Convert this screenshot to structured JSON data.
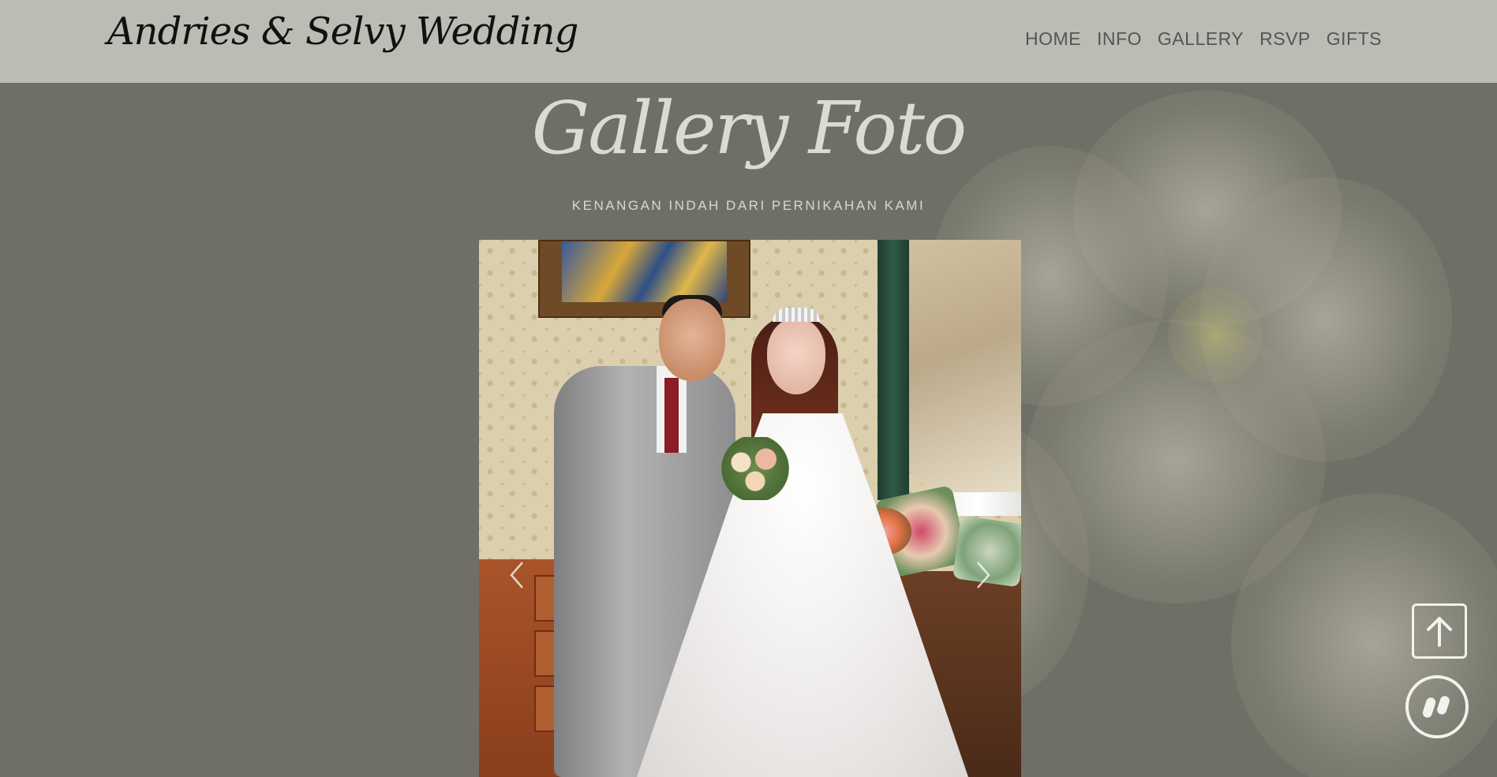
{
  "header": {
    "brand": "Andries & Selvy Wedding",
    "nav": [
      "HOME",
      "INFO",
      "GALLERY",
      "RSVP",
      "GIFTS"
    ]
  },
  "gallery": {
    "title": "Gallery Foto",
    "subtitle": "KENANGAN INDAH DARI PERNIKAHAN KAMI"
  },
  "icons": {
    "prev": "chevron-left-icon",
    "next": "chevron-right-icon",
    "back_to_top": "arrow-up-icon",
    "music": "pause-icon"
  },
  "colors": {
    "header_bg": "#bcbbb4",
    "page_bg": "#6f6f66",
    "title_text": "#dcdbd3",
    "button_outline": "#f2f2ee"
  }
}
